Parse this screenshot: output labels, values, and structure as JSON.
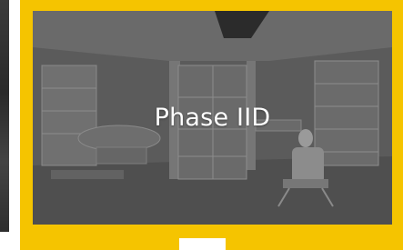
{
  "card": {
    "title": "Phase IID",
    "image_subject": "interior-rendering-photo",
    "frame_color": "#f5c400"
  }
}
